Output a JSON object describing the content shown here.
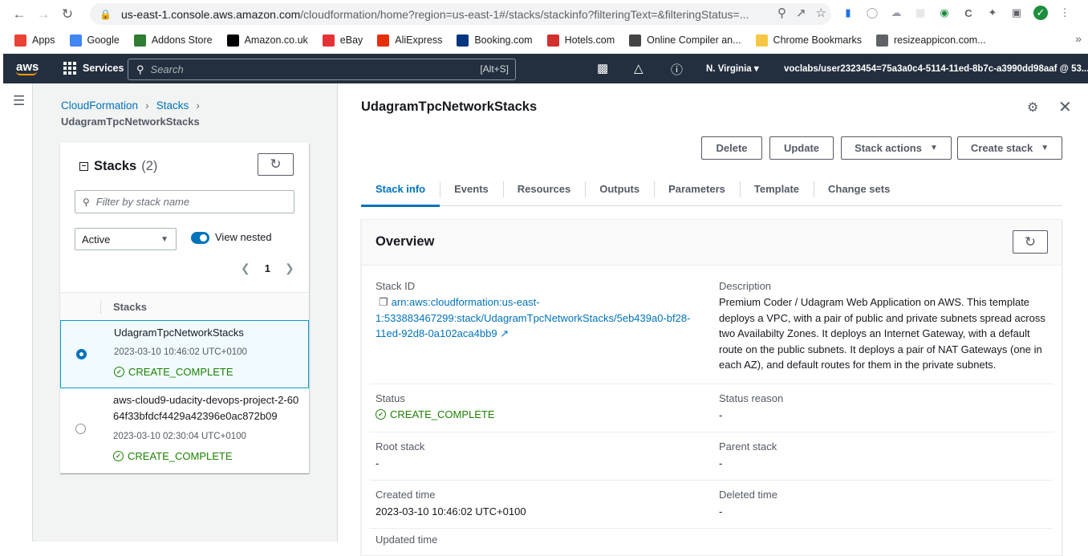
{
  "browser": {
    "url_host": "us-east-1.console.aws.amazon.com",
    "url_path": "/cloudformation/home?region=us-east-1#/stacks/stackinfo?filteringText=&filteringStatus=..."
  },
  "bookmarks": [
    {
      "label": "Apps",
      "icon": "apps-grid-icon",
      "color": "#ea4335"
    },
    {
      "label": "Google",
      "icon": "google-icon",
      "color": "#4285f4"
    },
    {
      "label": "Addons Store",
      "icon": "addons-store-icon",
      "color": "#2e7d32"
    },
    {
      "label": "Amazon.co.uk",
      "icon": "amazon-icon",
      "color": "#000000"
    },
    {
      "label": "eBay",
      "icon": "ebay-icon",
      "color": "#e53238"
    },
    {
      "label": "AliExpress",
      "icon": "aliexpress-icon",
      "color": "#e62e04"
    },
    {
      "label": "Booking.com",
      "icon": "booking-icon",
      "color": "#003580"
    },
    {
      "label": "Hotels.com",
      "icon": "hotels-icon",
      "color": "#d32f2f"
    },
    {
      "label": "Online Compiler an...",
      "icon": "compiler-icon",
      "color": "#444444"
    },
    {
      "label": "Chrome Bookmarks",
      "icon": "folder-icon",
      "color": "#f6c744"
    },
    {
      "label": "resizeappicon.com...",
      "icon": "globe-icon",
      "color": "#5f6368"
    }
  ],
  "header": {
    "logo": "aws",
    "services": "Services",
    "search_placeholder": "Search",
    "search_shortcut": "[Alt+S]",
    "region": "N. Virginia ▾",
    "account": "voclabs/user2323454=75a3a0c4-5114-11ed-8b7c-a3990dd98aaf @ 53... ▾"
  },
  "breadcrumb": {
    "items": [
      "CloudFormation",
      "Stacks"
    ],
    "current": "UdagramTpcNetworkStacks"
  },
  "stacks_panel": {
    "title": "Stacks",
    "count": "(2)",
    "filter_placeholder": "Filter by stack name",
    "status_filter": "Active",
    "view_nested": "View nested",
    "page": "1",
    "column_header": "Stacks",
    "rows": [
      {
        "name": "UdagramTpcNetworkStacks",
        "time": "2023-03-10 10:46:02 UTC+0100",
        "status": "CREATE_COMPLETE"
      },
      {
        "name": "aws-cloud9-udacity-devops-project-2-6064f33bfdcf4429a42396e0ac872b09",
        "time": "2023-03-10 02:30:04 UTC+0100",
        "status": "CREATE_COMPLETE"
      }
    ]
  },
  "detail": {
    "title": "UdagramTpcNetworkStacks",
    "buttons": {
      "delete": "Delete",
      "update": "Update",
      "stack_actions": "Stack actions",
      "create_stack": "Create stack"
    },
    "tabs": [
      "Stack info",
      "Events",
      "Resources",
      "Outputs",
      "Parameters",
      "Template",
      "Change sets"
    ],
    "overview": {
      "title": "Overview",
      "stack_id_label": "Stack ID",
      "stack_id_line1": "arn:aws:cloudformation:us-east-",
      "stack_id_line2": "1:533883467299:stack/UdagramTpcNetworkStacks/5eb439a0-bf28-",
      "stack_id_line3": "11ed-92d8-0a102aca4bb9",
      "description_label": "Description",
      "description_lines": [
        "Premium Coder / Udagram Web Application on AWS. This template",
        "deploys a VPC, with a pair of public and private subnets spread across",
        "two Availabilty Zones. It deploys an Internet Gateway, with a default",
        "route on the public subnets. It deploys a pair of NAT Gateways (one in",
        "each AZ), and default routes for them in the private subnets."
      ],
      "status_label": "Status",
      "status_value": "CREATE_COMPLETE",
      "status_reason_label": "Status reason",
      "status_reason_value": "-",
      "root_stack_label": "Root stack",
      "root_stack_value": "-",
      "parent_stack_label": "Parent stack",
      "parent_stack_value": "-",
      "created_time_label": "Created time",
      "created_time_value": "2023-03-10 10:46:02 UTC+0100",
      "deleted_time_label": "Deleted time",
      "deleted_time_value": "-",
      "updated_time_label": "Updated time"
    }
  }
}
